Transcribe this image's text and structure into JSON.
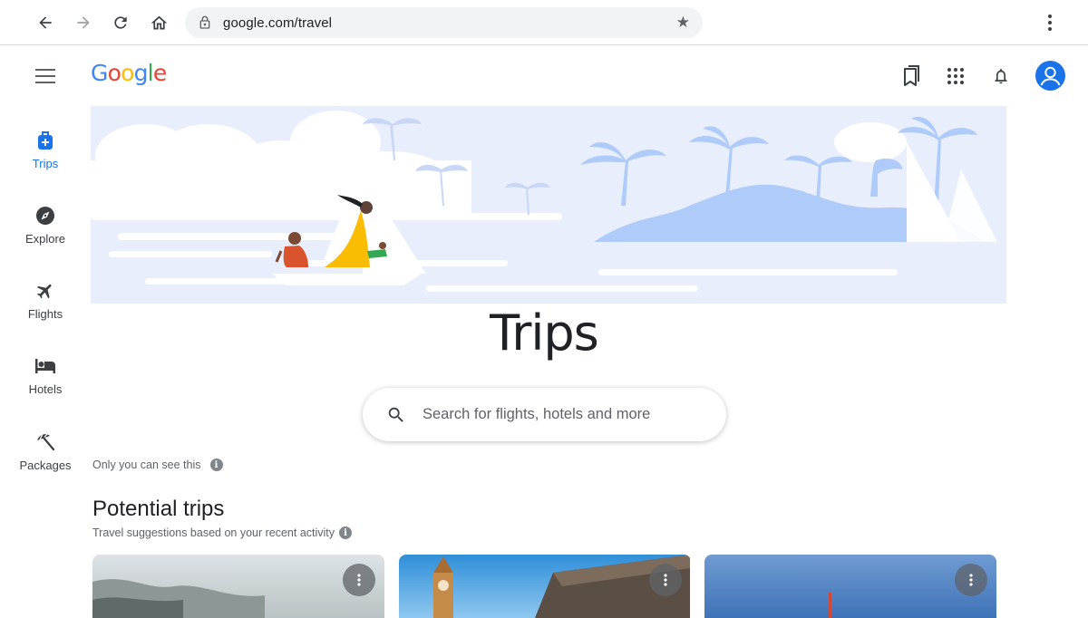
{
  "browser": {
    "url": "google.com/travel"
  },
  "app": {
    "logo_letters": [
      "G",
      "o",
      "o",
      "g",
      "l",
      "e"
    ],
    "logo_colors": [
      "#4285F4",
      "#EA4335",
      "#FBBC05",
      "#4285F4",
      "#34A853",
      "#EA4335"
    ]
  },
  "sidebar": {
    "items": [
      {
        "label": "Trips",
        "icon": "luggage-icon",
        "active": true
      },
      {
        "label": "Explore",
        "icon": "compass-icon",
        "active": false
      },
      {
        "label": "Flights",
        "icon": "airplane-icon",
        "active": false
      },
      {
        "label": "Hotels",
        "icon": "bed-icon",
        "active": false
      },
      {
        "label": "Packages",
        "icon": "beach-umbrella-icon",
        "active": false
      }
    ]
  },
  "main": {
    "title": "Trips",
    "search_placeholder": "Search for flights, hotels and more",
    "privacy_note": "Only you can see this",
    "section_title": "Potential trips",
    "section_subtitle": "Travel suggestions based on your recent activity"
  },
  "colors": {
    "accent": "#1a73e8",
    "hero_blue": "#aecbfa",
    "hero_bg": "#e8eefc"
  }
}
